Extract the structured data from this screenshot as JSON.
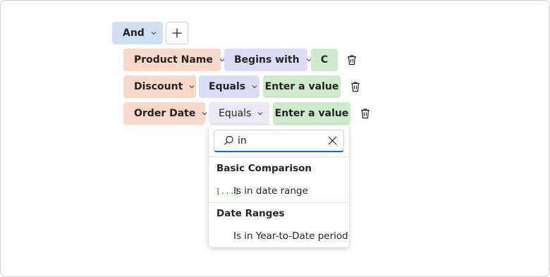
{
  "group": {
    "operator_label": "And"
  },
  "conditions": [
    {
      "field": "Product Name",
      "operator": "Begins with",
      "value": "C"
    },
    {
      "field": "Discount",
      "operator": "Equals",
      "value": "Enter a value"
    },
    {
      "field": "Order Date",
      "operator": "Equals",
      "value": "Enter a value"
    }
  ],
  "operator_menu": {
    "search_value": "in",
    "groups": [
      {
        "header": "Basic Comparison",
        "items": [
          {
            "label": "Is in date range",
            "icon": "[...]"
          }
        ]
      },
      {
        "header": "Date Ranges",
        "items": [
          {
            "label": "Is in Year-to-Date period",
            "icon": ""
          }
        ]
      }
    ]
  },
  "colors": {
    "field_chip": "#f8d8c9",
    "operator_chip": "#dcdcf4",
    "value_chip": "#cfe9cc",
    "group_chip": "#cfe0f5",
    "accent": "#0f6cbd"
  }
}
